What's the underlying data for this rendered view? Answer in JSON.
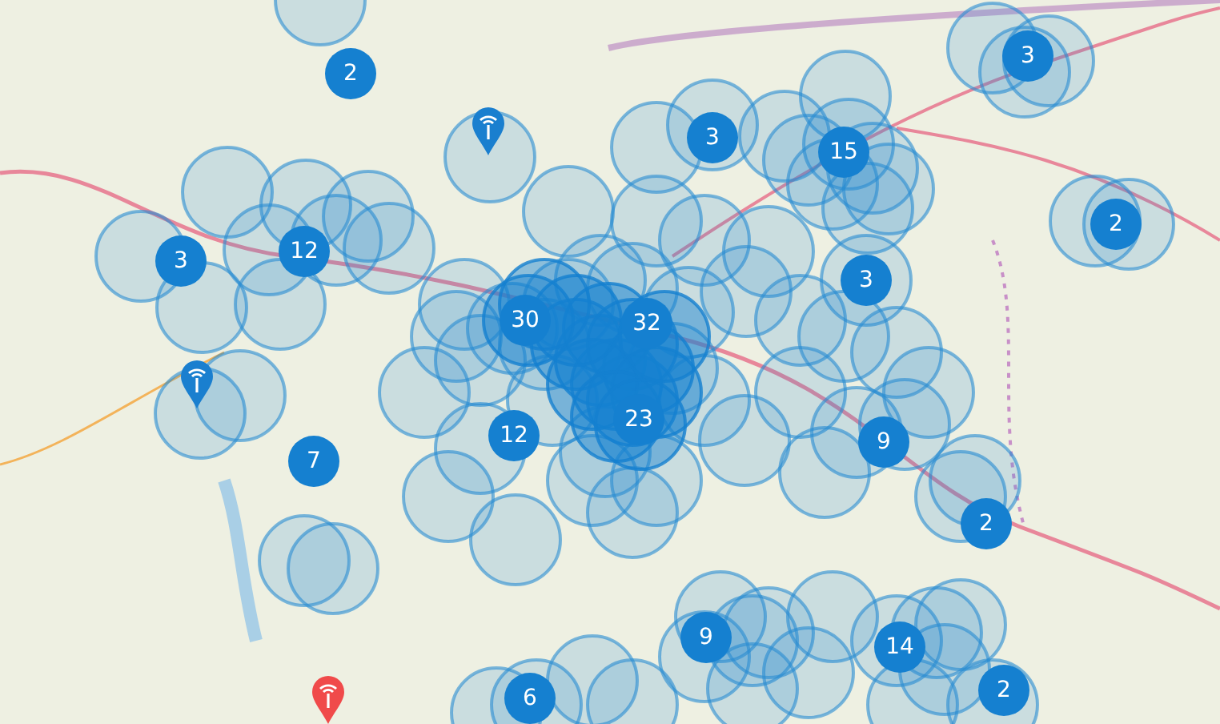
{
  "pins": [
    {
      "color": "#1a7fcf"
    },
    {
      "color": "#1a7fcf"
    },
    {
      "color": "#f04a4a"
    }
  ],
  "clusters": [
    {
      "count": "2"
    },
    {
      "count": "3"
    },
    {
      "count": "3"
    },
    {
      "count": "15"
    },
    {
      "count": "3"
    },
    {
      "count": "12"
    },
    {
      "count": "3"
    },
    {
      "count": "2"
    },
    {
      "count": "30"
    },
    {
      "count": "32"
    },
    {
      "count": "7"
    },
    {
      "count": "12"
    },
    {
      "count": "23"
    },
    {
      "count": "9"
    },
    {
      "count": "2"
    },
    {
      "count": "9"
    },
    {
      "count": "14"
    },
    {
      "count": "6"
    },
    {
      "count": "2"
    }
  ]
}
